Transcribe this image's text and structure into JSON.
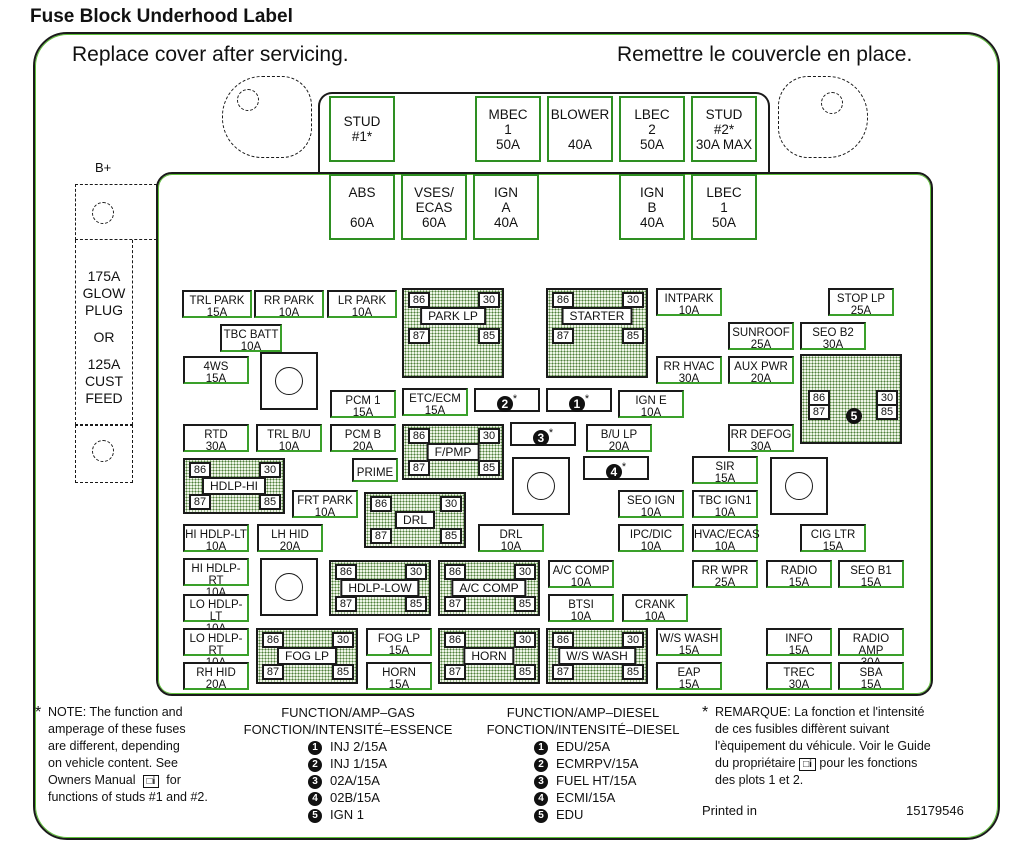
{
  "title": "Fuse Block  Underhood Label",
  "instructions": {
    "en": "Replace cover after servicing.",
    "fr": "Remettre le couvercle en place."
  },
  "side": {
    "terminal": "B+",
    "lines": [
      "175A",
      "GLOW",
      "PLUG",
      "OR",
      "125A",
      "CUST",
      "FEED"
    ]
  },
  "maxi_fuses": [
    {
      "id": "stud1",
      "name": "STUD",
      "sub": "#1*",
      "amp": ""
    },
    {
      "id": "mbec1",
      "name": "MBEC",
      "sub": "1",
      "amp": "50A"
    },
    {
      "id": "blower",
      "name": "BLOWER",
      "sub": "",
      "amp": "40A"
    },
    {
      "id": "lbec2",
      "name": "LBEC",
      "sub": "2",
      "amp": "50A"
    },
    {
      "id": "stud2",
      "name": "STUD",
      "sub": "#2*",
      "amp": "30A MAX"
    },
    {
      "id": "abs",
      "name": "ABS",
      "sub": "",
      "amp": "60A"
    },
    {
      "id": "vses",
      "name": "VSES/",
      "sub": "ECAS",
      "amp": "60A"
    },
    {
      "id": "igna",
      "name": "IGN",
      "sub": "A",
      "amp": "40A"
    },
    {
      "id": "ignb",
      "name": "IGN",
      "sub": "B",
      "amp": "40A"
    },
    {
      "id": "lbec1",
      "name": "LBEC",
      "sub": "1",
      "amp": "50A"
    }
  ],
  "mini_fuses": [
    {
      "id": "trl-park",
      "name": "TRL PARK",
      "amp": "15A"
    },
    {
      "id": "rr-park",
      "name": "RR PARK",
      "amp": "10A"
    },
    {
      "id": "lr-park",
      "name": "LR PARK",
      "amp": "10A"
    },
    {
      "id": "tbc-batt",
      "name": "TBC BATT",
      "amp": "10A"
    },
    {
      "id": "4ws",
      "name": "4WS",
      "amp": "15A"
    },
    {
      "id": "pcm1",
      "name": "PCM 1",
      "amp": "15A"
    },
    {
      "id": "etc-ecm",
      "name": "ETC/ECM",
      "amp": "15A"
    },
    {
      "id": "ign-e",
      "name": "IGN E",
      "amp": "10A"
    },
    {
      "id": "intpark",
      "name": "INTPARK",
      "amp": "10A"
    },
    {
      "id": "stop-lp",
      "name": "STOP LP",
      "amp": "25A"
    },
    {
      "id": "sunroof",
      "name": "SUNROOF",
      "amp": "25A"
    },
    {
      "id": "seo-b2",
      "name": "SEO B2",
      "amp": "30A"
    },
    {
      "id": "rr-hvac",
      "name": "RR HVAC",
      "amp": "30A"
    },
    {
      "id": "aux-pwr",
      "name": "AUX PWR",
      "amp": "20A"
    },
    {
      "id": "rtd",
      "name": "RTD",
      "amp": "30A"
    },
    {
      "id": "trl-bu",
      "name": "TRL B/U",
      "amp": "10A"
    },
    {
      "id": "pcm-b",
      "name": "PCM B",
      "amp": "20A"
    },
    {
      "id": "bu-lp",
      "name": "B/U LP",
      "amp": "20A"
    },
    {
      "id": "rr-defog",
      "name": "RR DEFOG",
      "amp": "30A"
    },
    {
      "id": "prime",
      "name": "PRIME",
      "amp": ""
    },
    {
      "id": "sir",
      "name": "SIR",
      "amp": "15A"
    },
    {
      "id": "frt-park",
      "name": "FRT PARK",
      "amp": "10A"
    },
    {
      "id": "seo-ign",
      "name": "SEO IGN",
      "amp": "10A"
    },
    {
      "id": "tbc-ign1",
      "name": "TBC IGN1",
      "amp": "10A"
    },
    {
      "id": "hi-hdlp-lt",
      "name": "HI HDLP-LT",
      "amp": "10A"
    },
    {
      "id": "lh-hid",
      "name": "LH HID",
      "amp": "20A"
    },
    {
      "id": "drl-fuse",
      "name": "DRL",
      "amp": "10A"
    },
    {
      "id": "ipc-dic",
      "name": "IPC/DIC",
      "amp": "10A"
    },
    {
      "id": "hvac-ecas",
      "name": "HVAC/ECAS",
      "amp": "10A"
    },
    {
      "id": "cig-ltr",
      "name": "CIG LTR",
      "amp": "15A"
    },
    {
      "id": "hi-hdlp-rt",
      "name": "HI HDLP-RT",
      "amp": "10A"
    },
    {
      "id": "ac-comp-fuse",
      "name": "A/C COMP",
      "amp": "10A"
    },
    {
      "id": "rr-wpr",
      "name": "RR WPR",
      "amp": "25A"
    },
    {
      "id": "radio",
      "name": "RADIO",
      "amp": "15A"
    },
    {
      "id": "seo-b1",
      "name": "SEO B1",
      "amp": "15A"
    },
    {
      "id": "lo-hdlp-lt",
      "name": "LO HDLP-LT",
      "amp": "10A"
    },
    {
      "id": "btsi",
      "name": "BTSI",
      "amp": "10A"
    },
    {
      "id": "crank",
      "name": "CRANK",
      "amp": "10A"
    },
    {
      "id": "lo-hdlp-rt",
      "name": "LO HDLP-RT",
      "amp": "10A"
    },
    {
      "id": "fog-lp-fuse",
      "name": "FOG LP",
      "amp": "15A"
    },
    {
      "id": "ws-wash-fuse",
      "name": "W/S WASH",
      "amp": "15A"
    },
    {
      "id": "info",
      "name": "INFO",
      "amp": "15A"
    },
    {
      "id": "radio-amp",
      "name": "RADIO AMP",
      "amp": "30A"
    },
    {
      "id": "rh-hid",
      "name": "RH HID",
      "amp": "20A"
    },
    {
      "id": "horn-fuse",
      "name": "HORN",
      "amp": "15A"
    },
    {
      "id": "eap",
      "name": "EAP",
      "amp": "15A"
    },
    {
      "id": "trec",
      "name": "TREC",
      "amp": "30A"
    },
    {
      "id": "sba",
      "name": "SBA",
      "amp": "15A"
    }
  ],
  "relays": [
    {
      "id": "park-lp",
      "name": "PARK LP"
    },
    {
      "id": "starter",
      "name": "STARTER"
    },
    {
      "id": "f-pmp",
      "name": "F/PMP"
    },
    {
      "id": "hdlp-hi",
      "name": "HDLP-HI"
    },
    {
      "id": "drl",
      "name": "DRL"
    },
    {
      "id": "hdlp-low",
      "name": "HDLP-LOW"
    },
    {
      "id": "ac-comp",
      "name": "A/C COMP"
    },
    {
      "id": "fog-lp",
      "name": "FOG LP"
    },
    {
      "id": "horn",
      "name": "HORN"
    },
    {
      "id": "ws-wash",
      "name": "W/S WASH"
    },
    {
      "id": "relay5",
      "name": "5"
    }
  ],
  "relay_pins": [
    "86",
    "30",
    "87",
    "85"
  ],
  "variable_slots": [
    {
      "num": "2",
      "mark": "*"
    },
    {
      "num": "1",
      "mark": "*"
    },
    {
      "num": "3",
      "mark": "*"
    },
    {
      "num": "4",
      "mark": "*"
    }
  ],
  "notes": {
    "en_star": "*",
    "en_lines": [
      "NOTE:  The function and",
      "amperage of these fuses",
      "are different, depending",
      "on vehicle content.  See",
      "Owners Manual",
      "for",
      "functions of studs #1 and #2."
    ],
    "fr_star": "*",
    "fr_lines": [
      "REMARQUE:  La fonction et l'intensité",
      "de ces fusibles diffèrent suivant",
      "l'èquipement du véhicule. Voir le Guide",
      "du propriétaire",
      "pour les fonctions",
      "des plots 1 et 2."
    ],
    "manual_icon": "i"
  },
  "gas": {
    "heading1": "FUNCTION/AMP–GAS",
    "heading2": "FONCTION/INTENSITÉ–ESSENCE",
    "items": [
      {
        "num": "1",
        "text": "INJ 2/15A"
      },
      {
        "num": "2",
        "text": "INJ 1/15A"
      },
      {
        "num": "3",
        "text": "02A/15A"
      },
      {
        "num": "4",
        "text": "02B/15A"
      },
      {
        "num": "5",
        "text": "IGN 1"
      }
    ]
  },
  "diesel": {
    "heading1": "FUNCTION/AMP–DIESEL",
    "heading2": "FONCTION/INTENSITÉ–DIESEL",
    "items": [
      {
        "num": "1",
        "text": "EDU/25A"
      },
      {
        "num": "2",
        "text": "ECMRPV/15A"
      },
      {
        "num": "3",
        "text": "FUEL HT/15A"
      },
      {
        "num": "4",
        "text": "ECMI/15A"
      },
      {
        "num": "5",
        "text": "EDU"
      }
    ]
  },
  "footer": {
    "printed_in": "Printed in",
    "part_number": "15179546"
  }
}
